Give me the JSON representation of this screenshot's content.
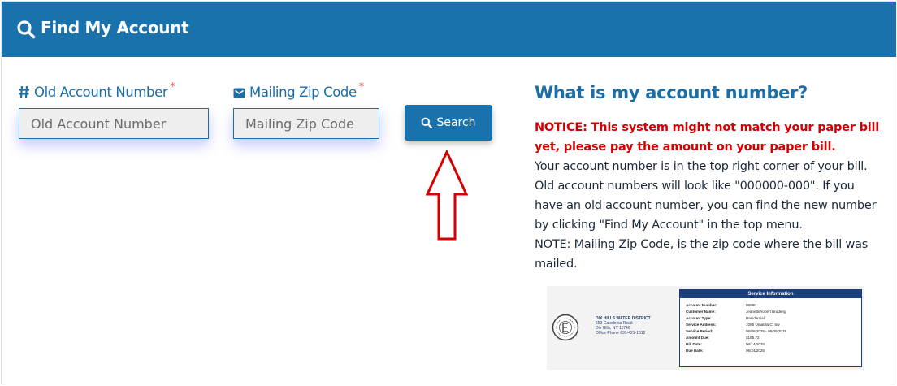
{
  "header": {
    "title": "Find My Account",
    "color": "#1a72ad"
  },
  "form": {
    "old_account": {
      "label": "Old Account Number",
      "required_mark": "*",
      "placeholder": "Old Account Number",
      "value": ""
    },
    "zip": {
      "label": "Mailing Zip Code",
      "required_mark": "*",
      "placeholder": "Mailing Zip Code",
      "value": ""
    },
    "search_label": "Search"
  },
  "help": {
    "title": "What is my account number?",
    "notice": "NOTICE: This system might not match your paper bill yet, please pay the amount on your paper bill.",
    "text": "Your account number is in the top right corner of your bill. Old account numbers will look like \"000000-000\". If you have an old account number, you can find the new number by clicking \"Find My Account\" in the top menu.",
    "note": "NOTE: Mailing Zip Code, is the zip code where the bill was mailed."
  },
  "bill_sample": {
    "district_name": "DIX HILLS WATER DISTRICT",
    "address1": "553 Caledonia Road",
    "address2": "Dix Hills, NY 11746",
    "phone": "Office Phone 631-421-1812",
    "service_title": "Service Information",
    "rows": [
      {
        "key": "Account Number:",
        "value": "99990"
      },
      {
        "key": "Customer Name:",
        "value": "Jeanette/robert Bruderig"
      },
      {
        "key": "Account Type:",
        "value": "Residential"
      },
      {
        "key": "Service Address:",
        "value": "1085 Umatilla Ct Sw"
      },
      {
        "key": "Service Period:",
        "value": "05/08/2025 - 06/09/2025"
      },
      {
        "key": "Amount Due:",
        "value": "$165.72"
      },
      {
        "key": "Bill Date:",
        "value": "06/14/2025"
      },
      {
        "key": "Due Date:",
        "value": "06/24/2025"
      }
    ]
  },
  "colors": {
    "accent": "#1a72ad",
    "notice": "#d40000",
    "arrow": "#d40000"
  }
}
